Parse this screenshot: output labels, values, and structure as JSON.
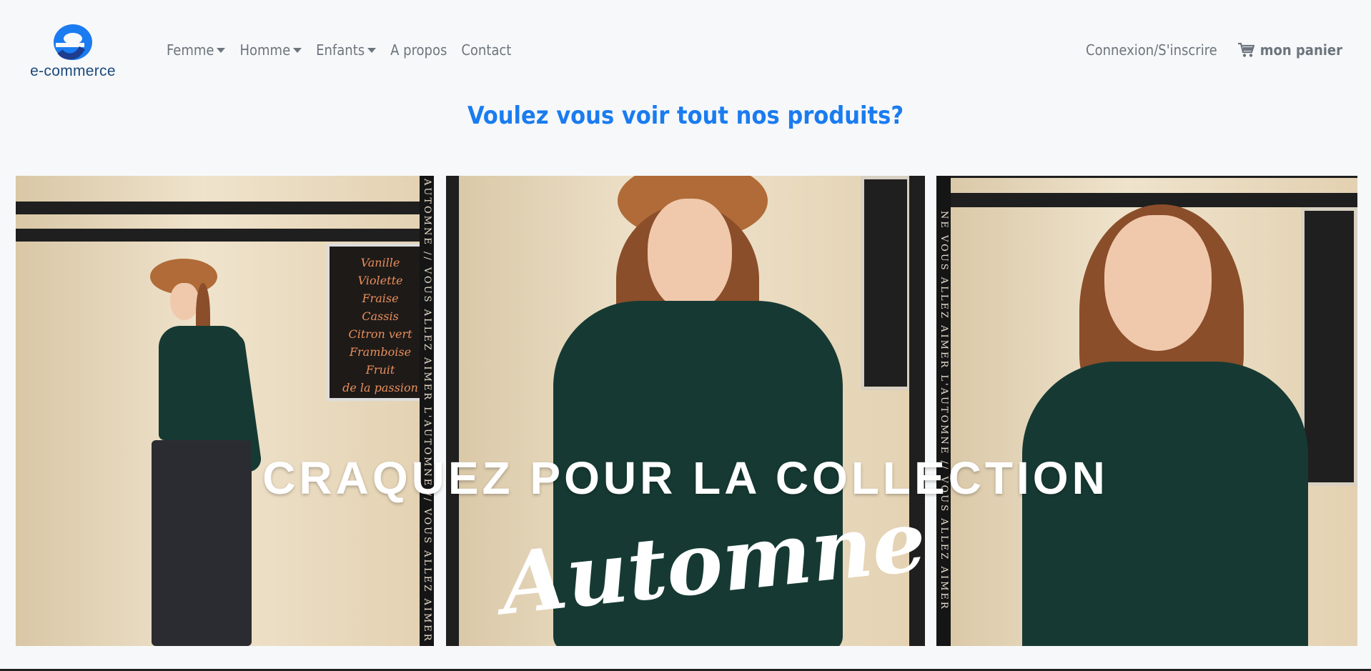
{
  "brand": {
    "logo_text": "e-commerce",
    "accent": "#1a7cf0"
  },
  "nav": {
    "items": [
      {
        "label": "Femme",
        "dropdown": true
      },
      {
        "label": "Homme",
        "dropdown": true
      },
      {
        "label": "Enfants",
        "dropdown": true
      },
      {
        "label": "A propos",
        "dropdown": false
      },
      {
        "label": "Contact",
        "dropdown": false
      }
    ],
    "login_label": "Connexion/S'inscrire",
    "cart_label": "mon panier",
    "cart_icon": "cart-icon"
  },
  "headline": "Voulez vous voir tout nos produits?",
  "banner": {
    "title": "CRAQUEZ POUR LA COLLECTION",
    "script": "Automne",
    "strip_text_left": "AUTOMNE // VOUS ALLEZ AIMER L'AUTOMNE // VOUS ALLEZ AIMER",
    "strip_text_right": "NE VOUS ALLEZ AIMER L'AUTOMNE // VOUS ALLEZ AIMER",
    "menu_lines": [
      "Vanille",
      "Violette",
      "Fraise",
      "Cassis",
      "Citron vert",
      "Framboise",
      "Fruit",
      "de la passion"
    ]
  }
}
